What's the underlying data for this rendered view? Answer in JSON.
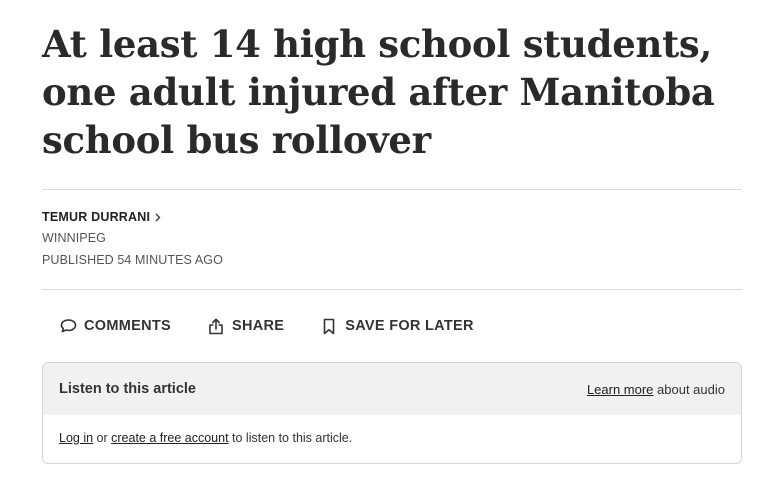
{
  "article": {
    "headline": "At least 14 high school students, one adult injured after Manitoba school bus rollover",
    "author": "TEMUR DURRANI",
    "location": "WINNIPEG",
    "published": "PUBLISHED 54 MINUTES AGO"
  },
  "actions": {
    "comments": "COMMENTS",
    "share": "SHARE",
    "save": "SAVE FOR LATER"
  },
  "audio": {
    "title": "Listen to this article",
    "learn_link": "Learn more",
    "learn_suffix": " about audio",
    "login_link": "Log in",
    "or_text": " or ",
    "create_link": "create a free account",
    "suffix": " to listen to this article."
  },
  "icons": [
    "chevron-right-icon",
    "comment-icon",
    "share-icon",
    "bookmark-icon"
  ]
}
